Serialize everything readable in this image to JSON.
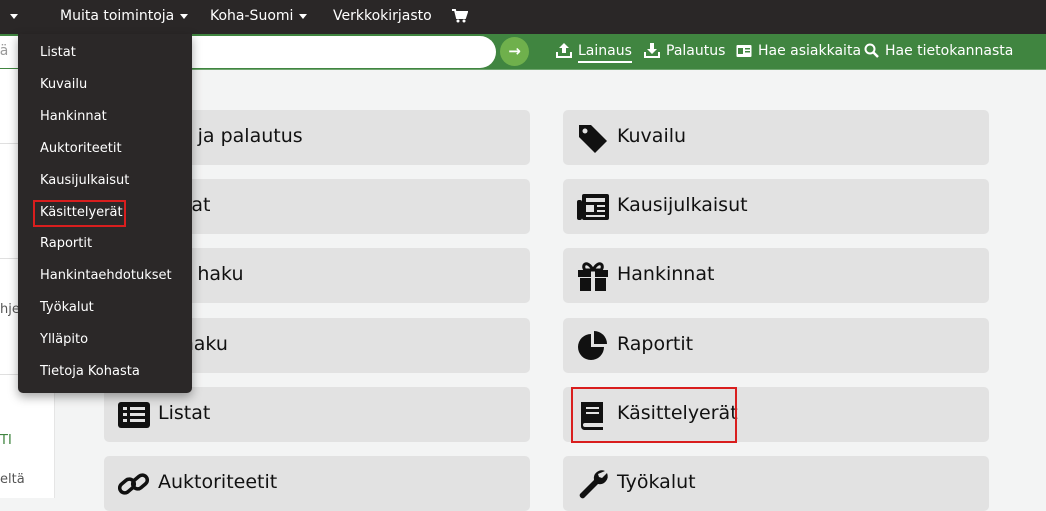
{
  "topnav": {
    "more": "Muita toimintoja",
    "koha_suomi": "Koha-Suomi",
    "opac": "Verkkokirjasto"
  },
  "search": {
    "placeholder_fragment": "stä"
  },
  "actions": {
    "checkout": "Lainaus",
    "checkin": "Palautus",
    "patrons": "Hae asiakkaita",
    "catalog": "Hae tietokannasta"
  },
  "left_panel": {
    "frag_hje": "hje",
    "frag_ti": "TI",
    "frag_elta": "eltä"
  },
  "tiles_left": [
    "aus ja palautus",
    "kkaat",
    "kka haku",
    "dehaku",
    "Listat",
    "Auktoriteetit"
  ],
  "tiles_right": [
    "Kuvailu",
    "Kausijulkaisut",
    "Hankinnat",
    "Raportit",
    "Käsittelyerät",
    "Työkalut"
  ],
  "dropdown_items": [
    "Listat",
    "Kuvailu",
    "Hankinnat",
    "Auktoriteetit",
    "Kausijulkaisut",
    "Käsittelyerät",
    "Raportit",
    "Hankintaehdotukset",
    "Työkalut",
    "Ylläpito",
    "Tietoja Kohasta"
  ],
  "icons": {
    "cart": "shopping-cart-icon",
    "checkout": "upload-icon",
    "checkin": "download-icon",
    "patrons": "id-card-icon",
    "catalog": "search-icon",
    "go": "arrow-right-icon"
  },
  "colors": {
    "topbar": "#2a2727",
    "greenbar": "#408540",
    "highlight": "#d91e1e"
  }
}
